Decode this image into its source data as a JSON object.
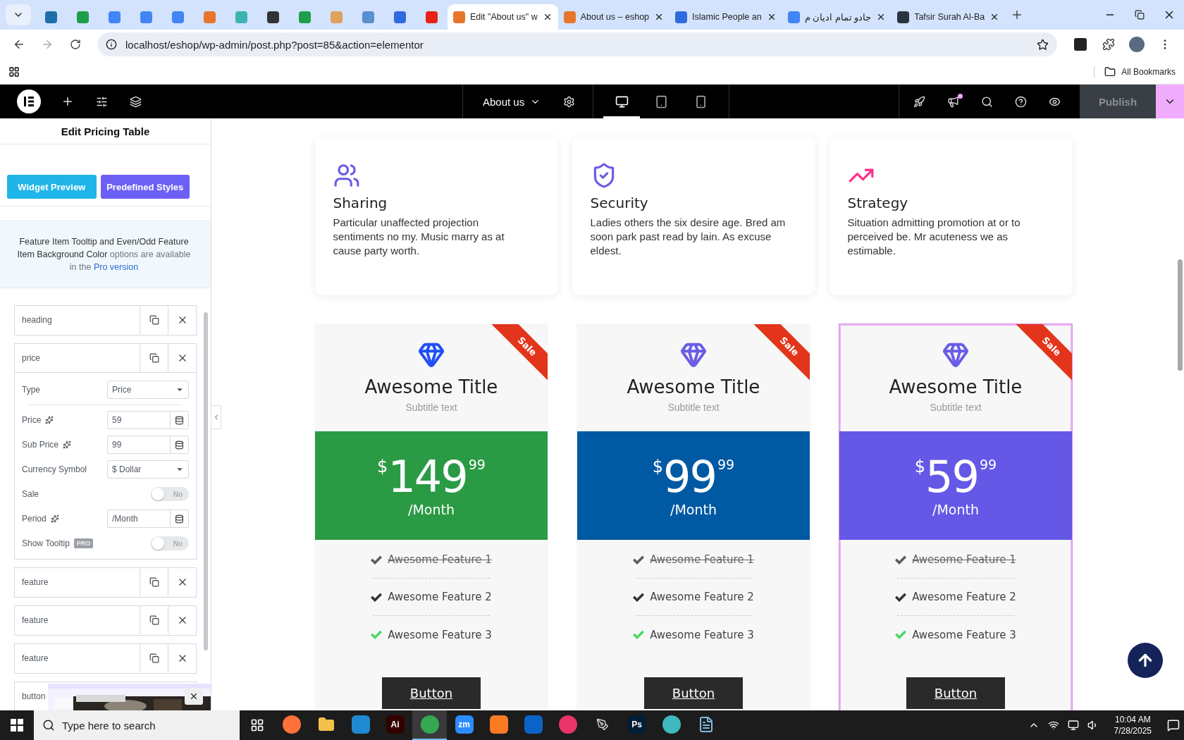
{
  "browser": {
    "tabs": [
      {
        "color": "#1e6fa8",
        "selected": false
      },
      {
        "color": "#1e9e4a",
        "selected": false
      },
      {
        "color": "#4285f4",
        "selected": false
      },
      {
        "color": "#4285f4",
        "selected": false
      },
      {
        "color": "#4285f4",
        "selected": false
      },
      {
        "color": "#e8752b",
        "selected": false
      },
      {
        "color": "#3bb3b0",
        "selected": false
      },
      {
        "color": "#333333",
        "selected": false
      },
      {
        "color": "#1e9e4a",
        "selected": false
      },
      {
        "color": "#e0a060",
        "selected": false
      },
      {
        "color": "#5a8fd0",
        "selected": false
      },
      {
        "color": "#2f6be0",
        "selected": false
      },
      {
        "color": "#e62117",
        "selected": false
      },
      {
        "title": "Edit \"About us\" w",
        "color": "#e8752b",
        "selected": true
      },
      {
        "title": "About us – eshop",
        "color": "#e8752b",
        "selected": false
      },
      {
        "title": "Islamic People an",
        "color": "#2f6be0",
        "selected": false
      },
      {
        "title": "جادو تمام ادیان م",
        "color": "#4285f4",
        "selected": false
      },
      {
        "title": "Tafsir Surah Al-Ba",
        "color": "#2a3340",
        "selected": false
      }
    ],
    "url": "localhost/eshop/wp-admin/post.php?post=85&action=elementor",
    "bookmarks_label": "All Bookmarks"
  },
  "editor": {
    "page_title": "About us",
    "devices": [
      {
        "kind": "desktop",
        "selected": true
      },
      {
        "kind": "tablet",
        "selected": false
      },
      {
        "kind": "mobile",
        "selected": false
      }
    ],
    "publish": "Publish",
    "publish_disabled": true
  },
  "panel": {
    "title": "Edit Pricing Table",
    "buttons": [
      "Widget Preview",
      "Predefined Styles"
    ],
    "notice": {
      "lead": "Feature Item Tooltip and Even/Odd Feature Item Background Color",
      "rest": " options are available in the ",
      "link": "Pro version"
    },
    "items": [
      {
        "label": "heading",
        "expanded": false
      },
      {
        "label": "price",
        "expanded": true,
        "fields": [
          {
            "kind": "select",
            "label": "Type",
            "value": "Price"
          },
          {
            "kind": "dynamic",
            "label": "Price",
            "value": "59"
          },
          {
            "kind": "dynamic",
            "label": "Sub Price",
            "value": "99"
          },
          {
            "kind": "select",
            "label": "Currency Symbol",
            "value": "$ Dollar"
          },
          {
            "kind": "toggle",
            "label": "Sale",
            "on": false,
            "state_text": "No"
          },
          {
            "kind": "dynamic",
            "label": "Period",
            "value": "/Month"
          },
          {
            "kind": "toggle",
            "label": "Show Tooltip",
            "badge": "PRO",
            "on": false,
            "state_text": "No"
          }
        ]
      },
      {
        "label": "feature",
        "expanded": false
      },
      {
        "label": "feature",
        "expanded": false
      },
      {
        "label": "feature",
        "expanded": false
      },
      {
        "label": "button",
        "expanded": false
      }
    ]
  },
  "features": [
    {
      "kind": "sharing",
      "title": "Sharing",
      "text": "Particular unaffected projection sentiments no my. Music marry as at cause party worth."
    },
    {
      "kind": "security",
      "title": "Security",
      "text": "Ladies others the six desire age. Bred am soon park past read by lain. As excuse eldest."
    },
    {
      "kind": "strategy",
      "title": "Strategy",
      "text": "Situation admitting promotion at or to perceived be. Mr acuteness we as estimable."
    }
  ],
  "pricing": [
    {
      "title": "Awesome Title",
      "subtitle": "Subtitle text",
      "ribbon": "Sale",
      "currency": "$",
      "price": "149",
      "cents": "99",
      "period": "/Month",
      "color": "#2b9a45",
      "icon": {
        "color": "#1f4ff5"
      },
      "selected": false,
      "items": [
        {
          "text": "Awesome Feature 1",
          "struck": true,
          "color": "#5a5a5a"
        },
        {
          "text": "Awesome Feature 2",
          "struck": false,
          "color": "#333333"
        },
        {
          "text": "Awesome Feature 3",
          "struck": false,
          "color": "#4cd964"
        }
      ],
      "button": "Button"
    },
    {
      "title": "Awesome Title",
      "subtitle": "Subtitle text",
      "ribbon": "Sale",
      "currency": "$",
      "price": "99",
      "cents": "99",
      "period": "/Month",
      "color": "#0059a3",
      "icon": {
        "color": "#6a5ce6"
      },
      "selected": false,
      "items": [
        {
          "text": "Awesome Feature 1",
          "struck": true,
          "color": "#5a5a5a"
        },
        {
          "text": "Awesome Feature 2",
          "struck": false,
          "color": "#333333"
        },
        {
          "text": "Awesome Feature 3",
          "struck": false,
          "color": "#4cd964"
        }
      ],
      "button": "Button"
    },
    {
      "title": "Awesome Title",
      "subtitle": "Subtitle text",
      "ribbon": "Sale",
      "currency": "$",
      "price": "59",
      "cents": "99",
      "period": "/Month",
      "color": "#6558e6",
      "icon": {
        "color": "#6a5ce6"
      },
      "selected": true,
      "items": [
        {
          "text": "Awesome Feature 1",
          "struck": true,
          "color": "#5a5a5a"
        },
        {
          "text": "Awesome Feature 2",
          "struck": false,
          "color": "#333333"
        },
        {
          "text": "Awesome Feature 3",
          "struck": false,
          "color": "#4cd964"
        }
      ],
      "button": "Button"
    }
  ],
  "taskbar": {
    "search_placeholder": "Type here to search",
    "apps": [
      {
        "kind": "firefox",
        "color": "#ff7139",
        "selected": false
      },
      {
        "kind": "folder",
        "color": "#f3c14a",
        "selected": false
      },
      {
        "kind": "code",
        "color": "#1f8ad2",
        "selected": false
      },
      {
        "kind": "letters",
        "label": "Ai",
        "color": "#330000",
        "selected": false
      },
      {
        "kind": "chrome",
        "color": "#34a853",
        "selected": true
      },
      {
        "kind": "letters",
        "label": "zm",
        "color": "#2d8cff",
        "selected": false
      },
      {
        "kind": "xampp",
        "color": "#fb7a24",
        "selected": false
      },
      {
        "kind": "outlook",
        "color": "#0a64c8",
        "selected": false
      },
      {
        "kind": "cloud",
        "color": "#e8346a",
        "selected": false
      },
      {
        "kind": "pen",
        "color": "#cccccc",
        "selected": false
      },
      {
        "kind": "letters",
        "label": "Ps",
        "color": "#001e36",
        "selected": false
      },
      {
        "kind": "gem",
        "color": "#3fb8c0",
        "selected": false
      },
      {
        "kind": "notepad",
        "color": "#7fb8e0",
        "selected": false
      }
    ],
    "time": "10:04 AM",
    "date": "7/28/2025"
  }
}
